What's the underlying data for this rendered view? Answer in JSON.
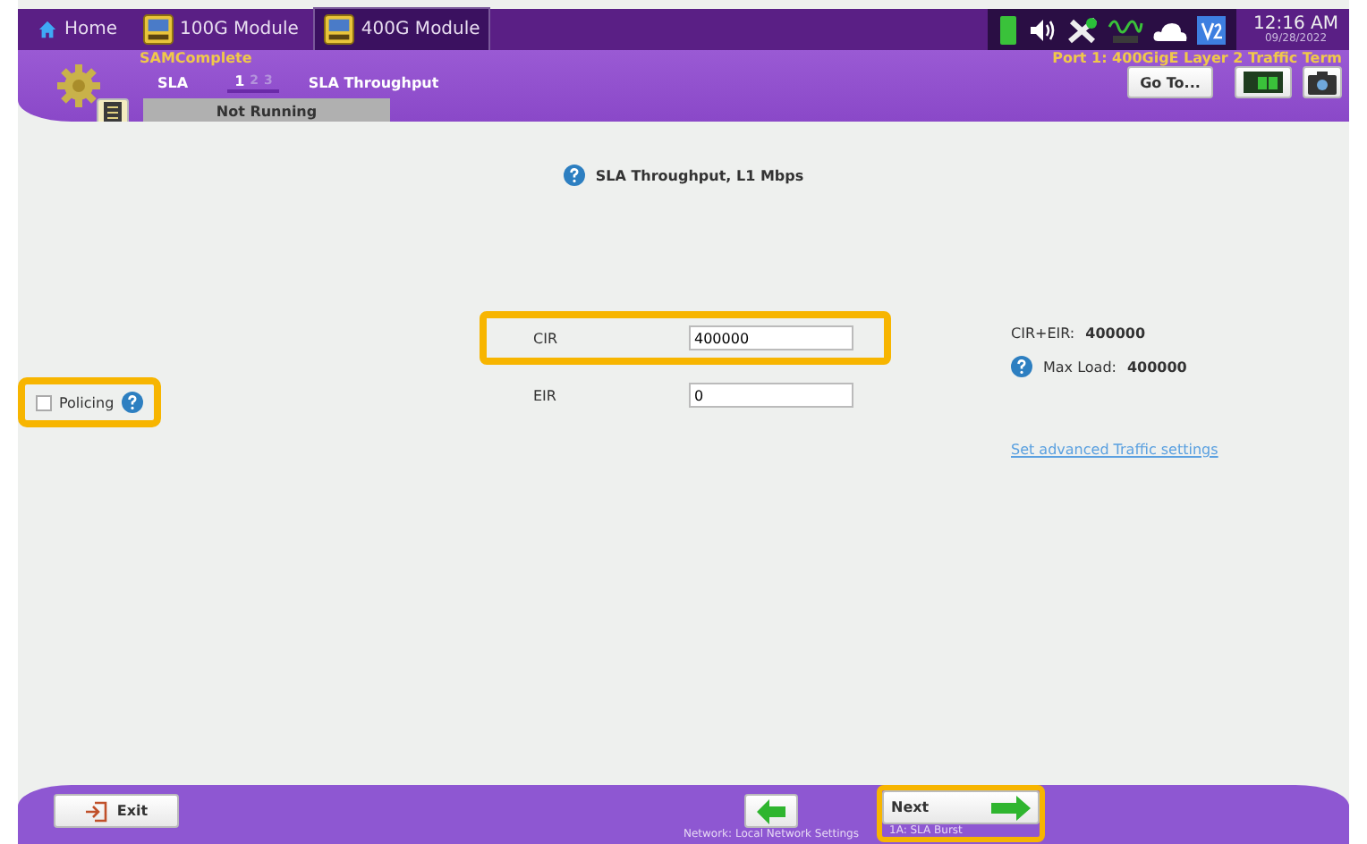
{
  "top_bar": {
    "tabs": [
      {
        "label": "Home",
        "kind": "home",
        "selected": false
      },
      {
        "label": "100G Module",
        "kind": "module",
        "selected": false
      },
      {
        "label": "400G Module",
        "kind": "module",
        "selected": true
      }
    ],
    "clock": {
      "time": "12:16 AM",
      "date": "09/28/2022"
    }
  },
  "header": {
    "app": "SAMComplete",
    "section": "SLA",
    "steps": [
      {
        "label": "1",
        "selected": true
      },
      {
        "label": "2",
        "selected": false
      },
      {
        "label": "3",
        "selected": false
      }
    ],
    "page": "SLA Throughput",
    "port": "Port 1: 400GigE Layer 2 Traffic Term",
    "goto": "Go To...",
    "status": "Not Running"
  },
  "content": {
    "title": "SLA Throughput, L1 Mbps",
    "fields": [
      {
        "label": "CIR",
        "value": "400000",
        "highlighted": true
      },
      {
        "label": "EIR",
        "value": "0",
        "highlighted": false
      }
    ],
    "sum": {
      "label": "CIR+EIR:",
      "value": "400000"
    },
    "max_load": {
      "label": "Max Load:",
      "value": "400000"
    },
    "policing": {
      "label": "Policing",
      "checked": false,
      "highlighted": true
    },
    "link": "Set advanced Traffic settings"
  },
  "bottom_bar": {
    "exit": "Exit",
    "back_caption": "Network: Local Network Settings",
    "next": {
      "label": "Next",
      "caption": "1A: SLA Burst",
      "highlighted": true
    }
  }
}
